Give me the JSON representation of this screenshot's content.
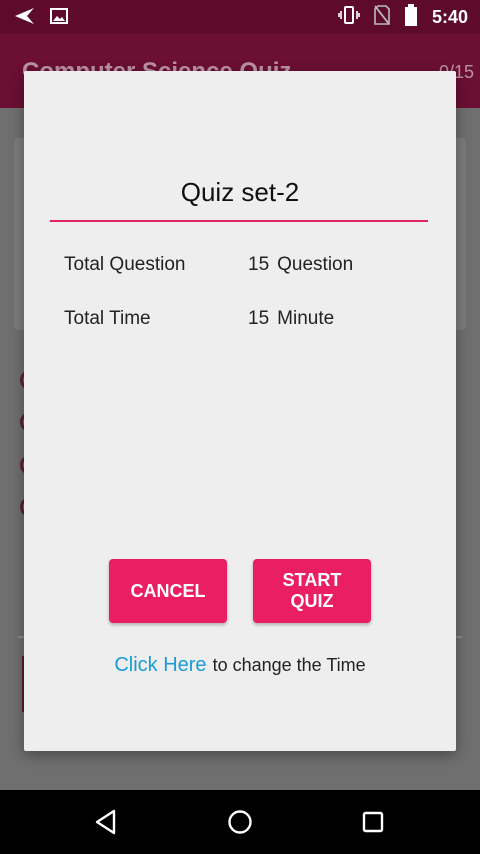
{
  "status_bar": {
    "time": "5:40"
  },
  "app_bar": {
    "title": "Computer Science Quiz",
    "counter": "0/15"
  },
  "dialog": {
    "title": "Quiz set-2",
    "rows": [
      {
        "label": "Total Question",
        "value": "15",
        "unit": "Question"
      },
      {
        "label": "Total Time",
        "value": "15",
        "unit": "Minute"
      }
    ],
    "buttons": {
      "cancel": "CANCEL",
      "start": "START QUIZ"
    },
    "footer": {
      "link": "Click Here",
      "text": "to change the Time"
    }
  },
  "colors": {
    "accent": "#e91e63",
    "link": "#1a9bd7",
    "status_bar": "#5e0a2a"
  }
}
